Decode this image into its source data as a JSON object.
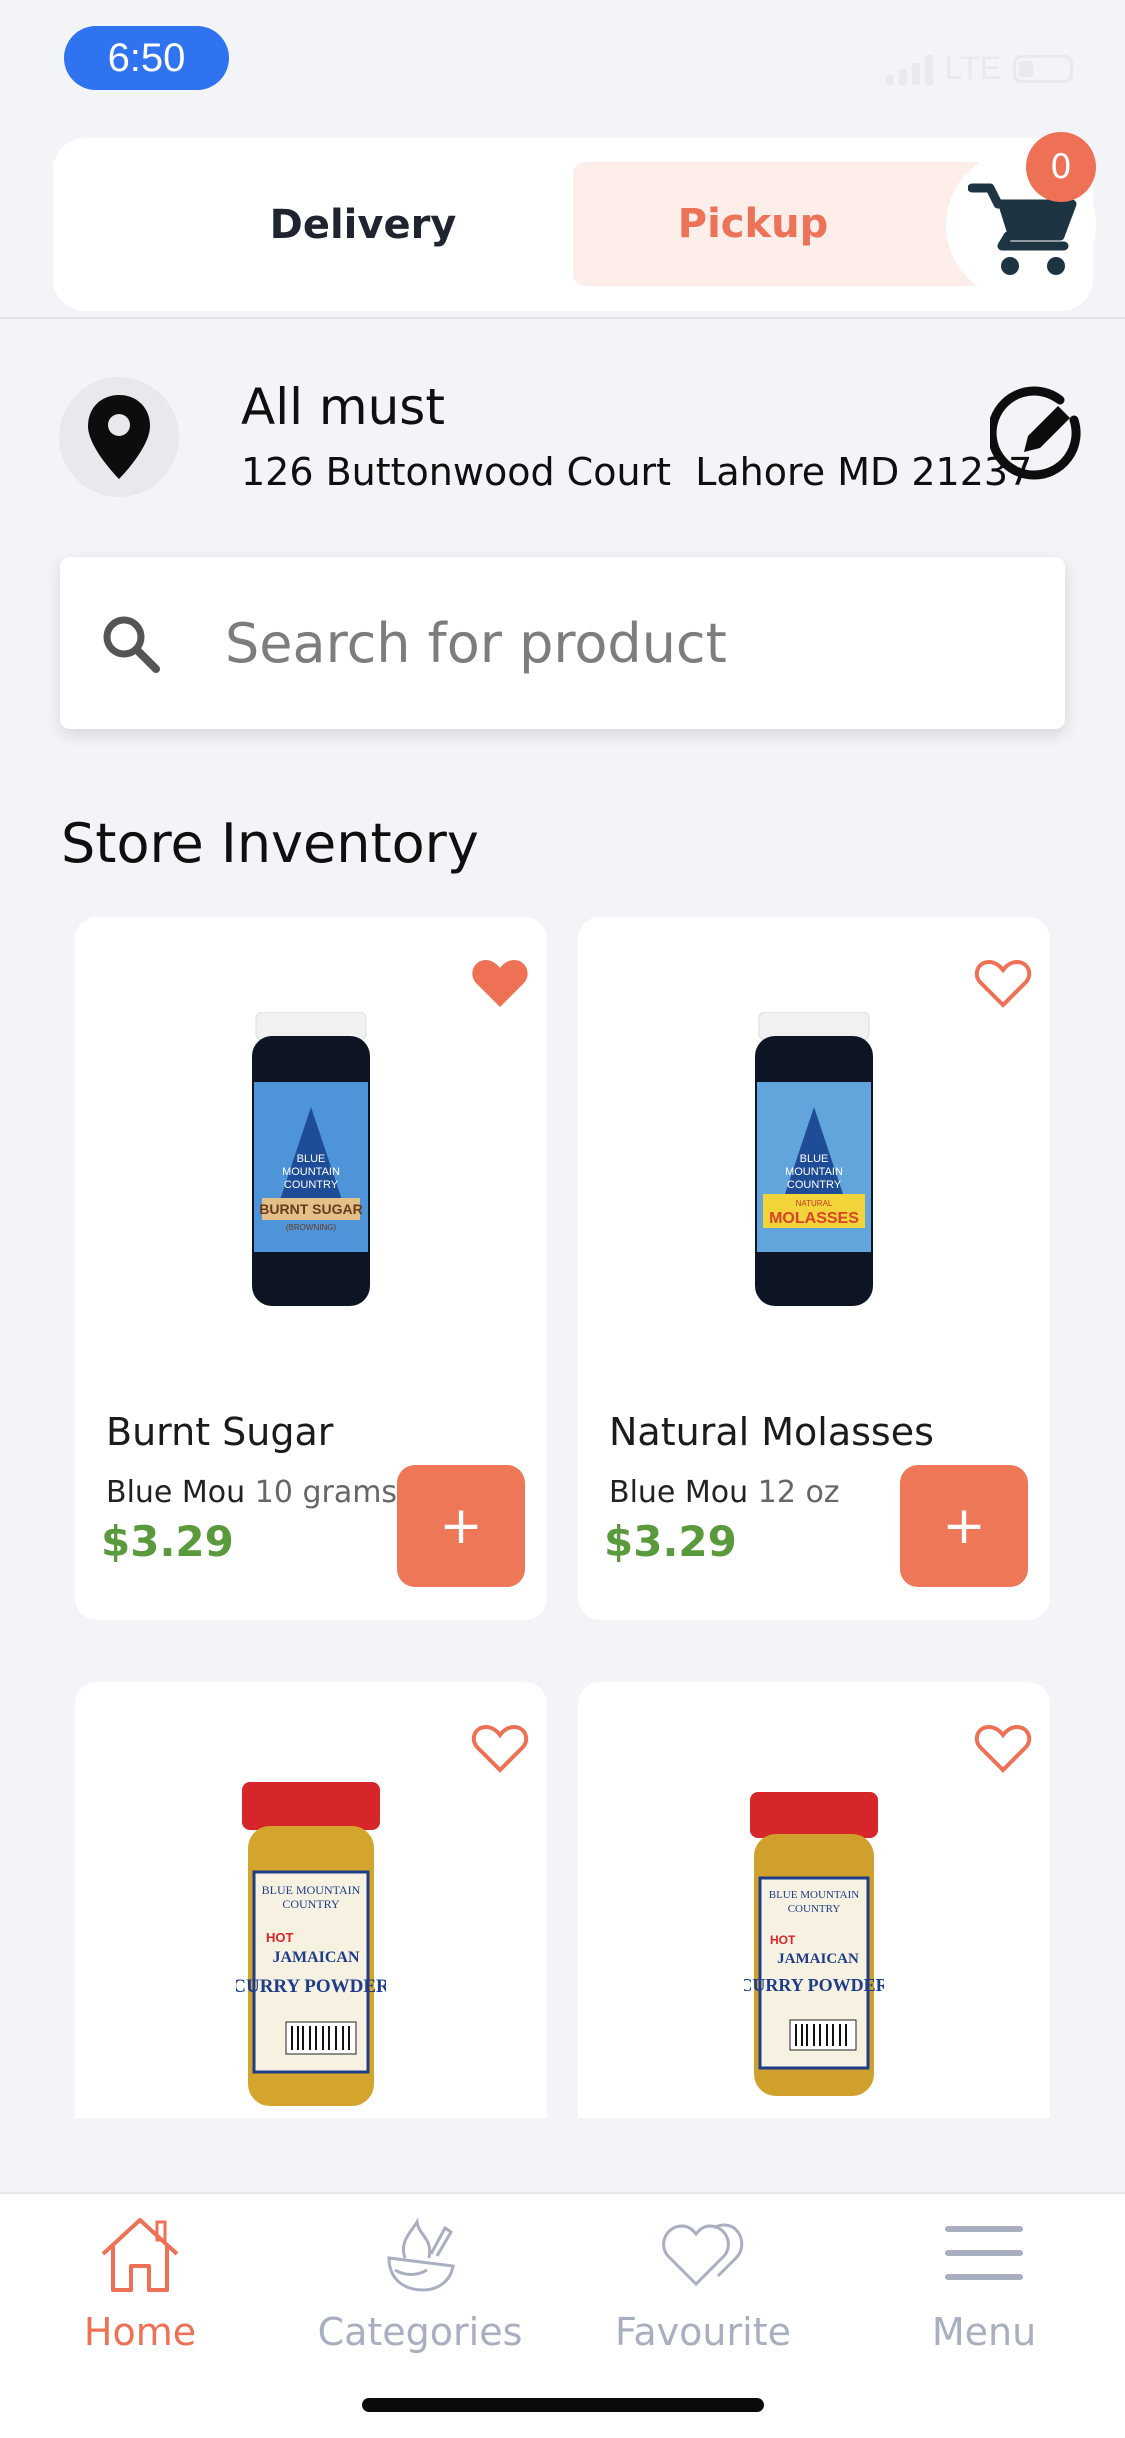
{
  "status_bar": {
    "time": "6:50",
    "network": "LTE"
  },
  "order_mode": {
    "delivery_label": "Delivery",
    "pickup_label": "Pickup",
    "selected": "Pickup"
  },
  "cart": {
    "count": "0"
  },
  "address": {
    "name": "All must",
    "line": "126 Buttonwood Court  Lahore MD 21237"
  },
  "search": {
    "placeholder": "Search for product"
  },
  "inventory": {
    "title": "Store Inventory",
    "products": [
      {
        "name": "Burnt Sugar",
        "brand": "Blue Mou",
        "size": "10 grams",
        "price": "$3.29",
        "favourite": true,
        "add_label": "+"
      },
      {
        "name": "Natural Molasses",
        "brand": "Blue Mou",
        "size": "12 oz",
        "price": "$3.29",
        "favourite": false,
        "add_label": "+"
      },
      {
        "name": "",
        "brand": "",
        "size": "",
        "price": "",
        "favourite": false
      },
      {
        "name": "",
        "brand": "",
        "size": "",
        "price": "",
        "favourite": false
      }
    ]
  },
  "product_labels": {
    "burnt_sugar": [
      "BLUE",
      "MOUNTAIN",
      "COUNTRY",
      "BURNT SUGAR",
      "(BROWNING)"
    ],
    "molasses": [
      "BLUE",
      "MOUNTAIN",
      "COUNTRY",
      "NATURAL",
      "MOLASSES"
    ],
    "curry": [
      "BLUE MOUNTAIN",
      "COUNTRY",
      "HOT",
      "JAMAICAN",
      "CURRY POWDER"
    ]
  },
  "bottom_nav": {
    "items": [
      {
        "label": "Home",
        "icon": "home-icon",
        "active": true
      },
      {
        "label": "Categories",
        "icon": "categories-icon",
        "active": false
      },
      {
        "label": "Favourite",
        "icon": "heart-icon",
        "active": false
      },
      {
        "label": "Menu",
        "icon": "menu-icon",
        "active": false
      }
    ]
  },
  "colors": {
    "accent": "#ee7155",
    "price": "#5a9a3c",
    "status_pill": "#2f73f0",
    "nav_inactive": "#a9aec0"
  }
}
